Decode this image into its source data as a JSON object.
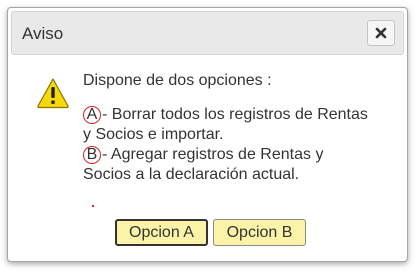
{
  "dialog": {
    "title": "Aviso",
    "close_label": "×",
    "intro": "Dispone de dos opciones :",
    "option_a": {
      "marker": "A",
      "line1": "- Borrar todos los registros de Rentas",
      "line2": "y Socios e importar."
    },
    "option_b": {
      "marker": "B",
      "line1": "- Agregar registros de Rentas y",
      "line2": "Socios a la declaración actual."
    }
  },
  "buttons": {
    "option_a_label": "Opcion A",
    "option_b_label": "Opcion B"
  },
  "colors": {
    "button_fill": "#fbf3a8",
    "marker_circle": "#d9232e",
    "warning_yellow": "#f5d90a"
  },
  "icons": {
    "warning": "warning-icon",
    "close": "close-icon"
  }
}
